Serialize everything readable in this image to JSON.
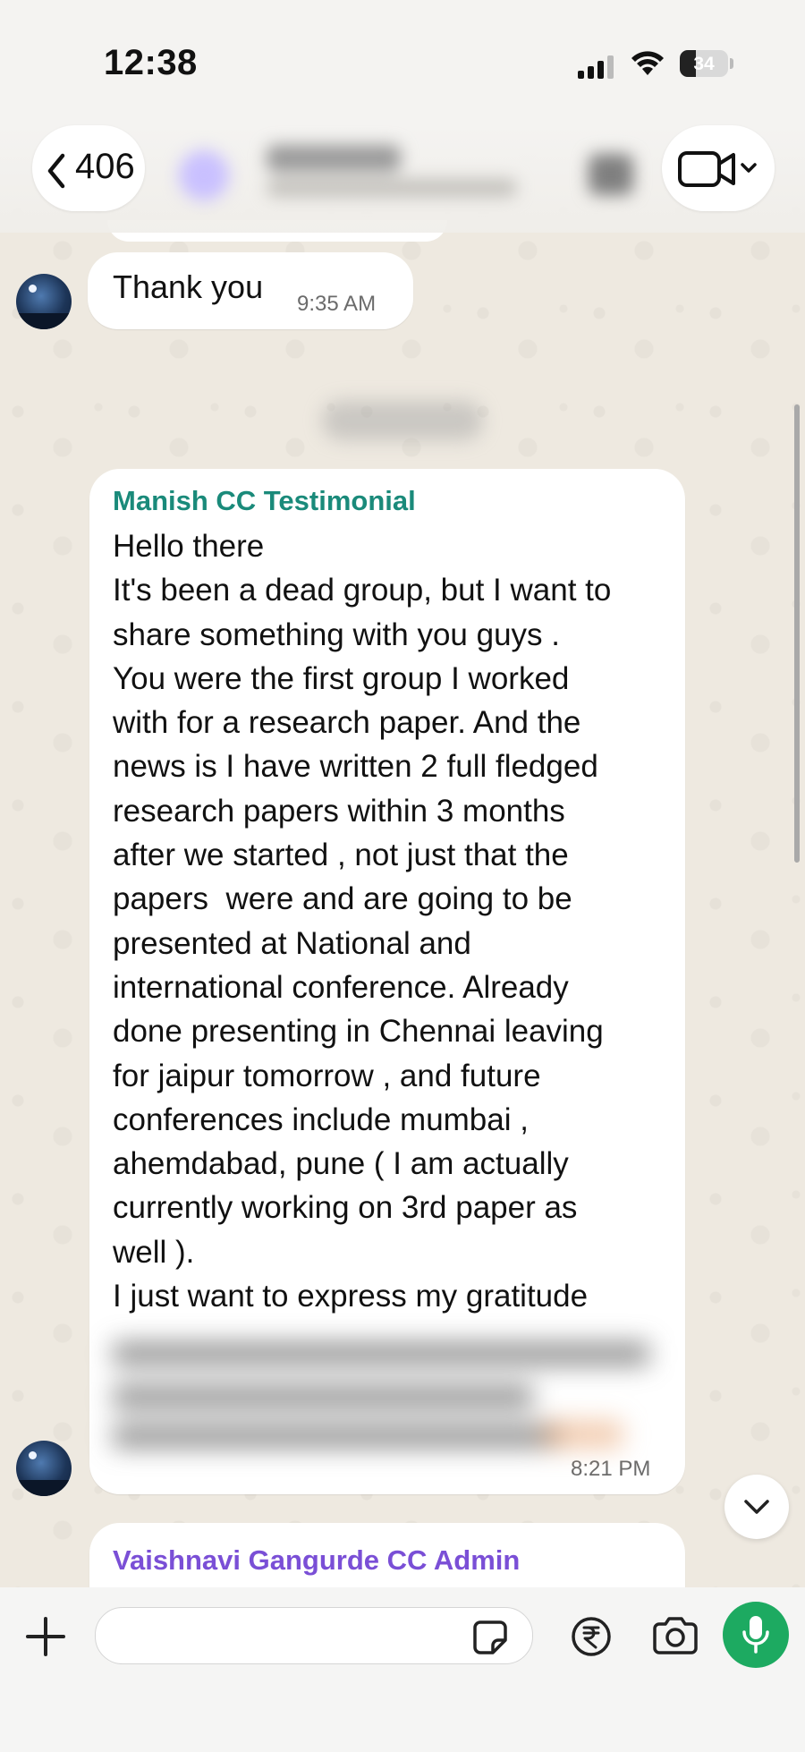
{
  "status_bar": {
    "time": "12:38",
    "battery_percent": "34",
    "battery_level": 0.34
  },
  "header": {
    "back_count": "406",
    "video_icon": "video-camera-icon"
  },
  "messages": [
    {
      "text": "Thank you",
      "time": "9:35 AM"
    },
    {
      "sender": "Manish CC Testimonial",
      "sender_color": "#1a8a7a",
      "lines": [
        "Hello there",
        "It's been a dead group, but I want to",
        "share something with you guys .",
        "You were the first group I worked",
        "with for a research paper. And the",
        "news is I have written 2 full fledged",
        "research papers within 3 months",
        "after we started , not just that the",
        "papers  were and are going to be",
        "presented at National and",
        "international conference. Already",
        "done presenting in Chennai leaving",
        "for jaipur tomorrow , and future",
        "conferences include mumbai ,",
        "ahemdabad, pune ( I am actually",
        "currently working on 3rd paper as",
        "well ).",
        "I just want to express my gratitude"
      ],
      "time": "8:21 PM"
    },
    {
      "sender": "Vaishnavi Gangurde CC Admin",
      "sender_color": "#7a4fd6"
    }
  ],
  "colors": {
    "mic_green": "#1daa61",
    "chat_background": "#eee9e0"
  }
}
